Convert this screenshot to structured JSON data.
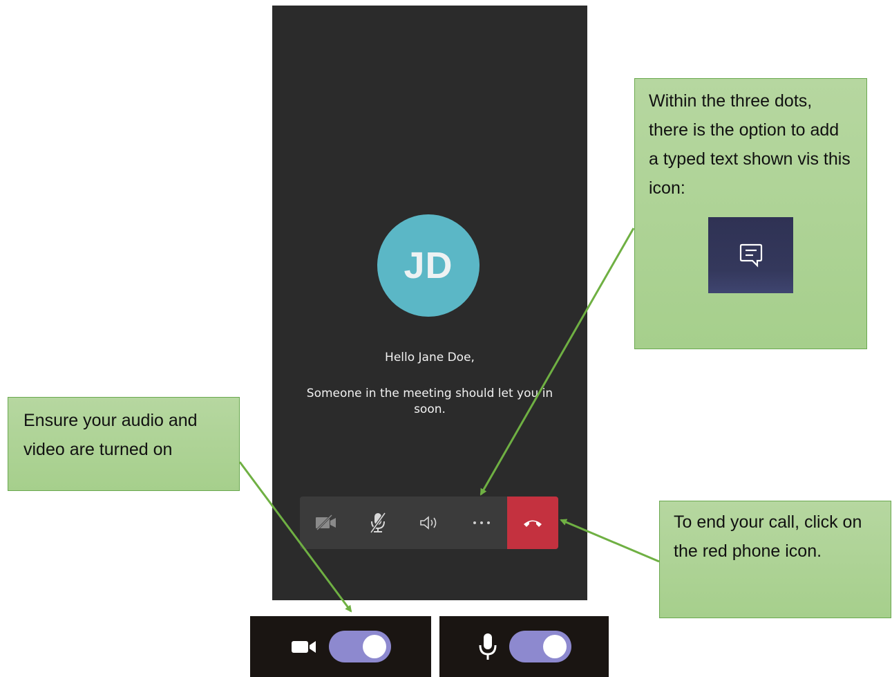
{
  "call": {
    "initials": "JD",
    "greeting": "Hello Jane Doe,",
    "status_message": "Someone in the meeting should let you in soon.",
    "avatar_color": "#5bb7c6",
    "end_call_color": "#c4313f"
  },
  "controls": [
    {
      "name": "camera-off-icon",
      "state": "off"
    },
    {
      "name": "mic-muted-icon",
      "state": "muted"
    },
    {
      "name": "speaker-icon",
      "state": "on"
    },
    {
      "name": "more-options-icon",
      "state": "menu"
    },
    {
      "name": "hang-up-icon",
      "state": "end"
    }
  ],
  "callouts": {
    "three_dots": "Within the three dots, there is the option to add a typed text shown vis this icon:",
    "audio_video": "Ensure your audio and video are turned on",
    "end_call": "To end your call, click on the red phone icon."
  },
  "toggles": [
    {
      "icon": "video-camera-icon",
      "state": "on",
      "color": "#8d89cf"
    },
    {
      "icon": "microphone-icon",
      "state": "on",
      "color": "#8d89cf"
    }
  ],
  "callout_color": "#a9d08e",
  "arrow_color": "#6fb043"
}
